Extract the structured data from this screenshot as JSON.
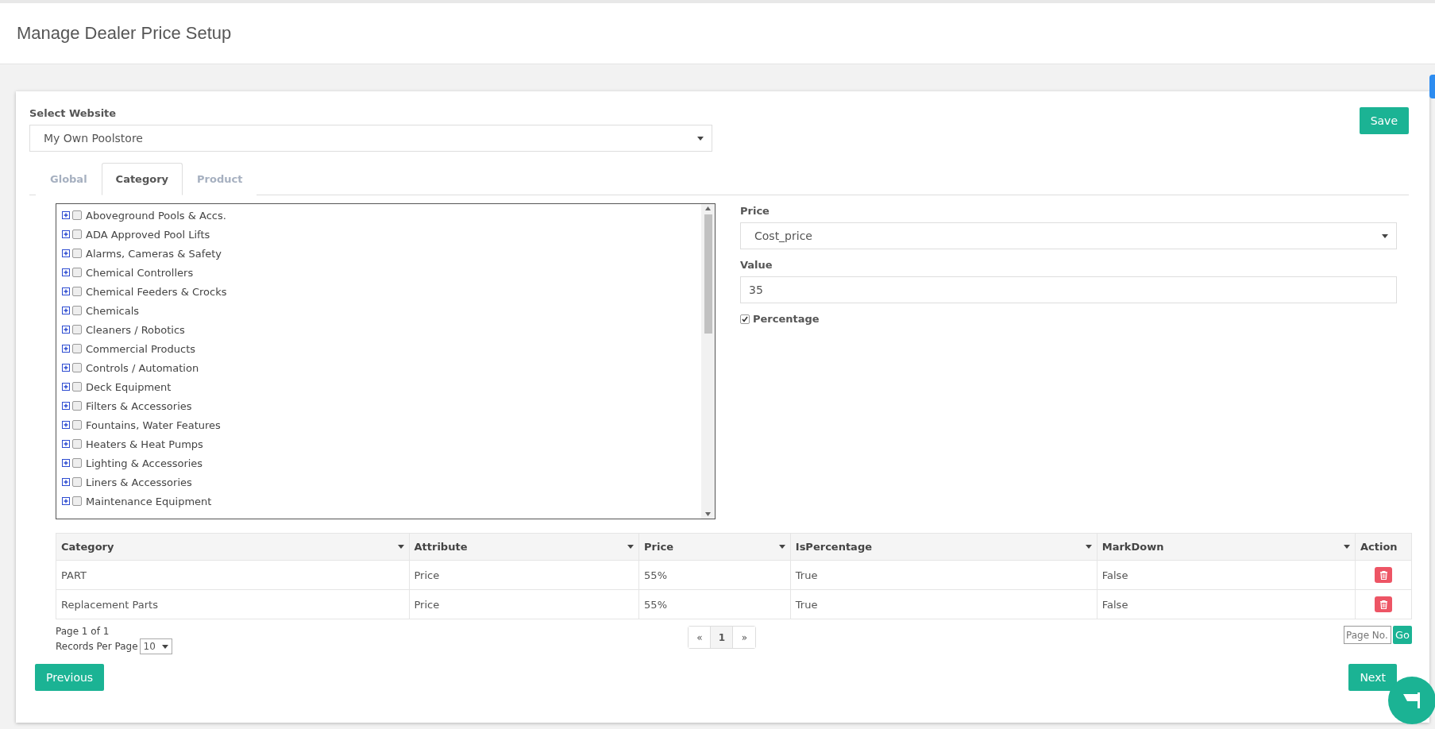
{
  "page_title": "Manage Dealer Price Setup",
  "website": {
    "label": "Select Website",
    "value": "My Own Poolstore"
  },
  "save_button": "Save",
  "tabs": [
    {
      "label": "Global",
      "selected": false
    },
    {
      "label": "Category",
      "selected": true
    },
    {
      "label": "Product",
      "selected": false
    }
  ],
  "category_tree": [
    {
      "label": "Aboveground Pools & Accs.",
      "checked": false,
      "expanded": false
    },
    {
      "label": "ADA Approved Pool Lifts",
      "checked": false,
      "expanded": false
    },
    {
      "label": "Alarms, Cameras & Safety",
      "checked": false,
      "expanded": false
    },
    {
      "label": "Chemical Controllers",
      "checked": false,
      "expanded": false
    },
    {
      "label": "Chemical Feeders & Crocks",
      "checked": false,
      "expanded": false
    },
    {
      "label": "Chemicals",
      "checked": false,
      "expanded": false
    },
    {
      "label": "Cleaners / Robotics",
      "checked": false,
      "expanded": false
    },
    {
      "label": "Commercial Products",
      "checked": false,
      "expanded": false
    },
    {
      "label": "Controls / Automation",
      "checked": false,
      "expanded": false
    },
    {
      "label": "Deck Equipment",
      "checked": false,
      "expanded": false
    },
    {
      "label": "Filters & Accessories",
      "checked": false,
      "expanded": false
    },
    {
      "label": "Fountains, Water Features",
      "checked": false,
      "expanded": false
    },
    {
      "label": "Heaters & Heat Pumps",
      "checked": false,
      "expanded": false
    },
    {
      "label": "Lighting & Accessories",
      "checked": false,
      "expanded": false
    },
    {
      "label": "Liners & Accessories",
      "checked": false,
      "expanded": false
    },
    {
      "label": "Maintenance Equipment",
      "checked": false,
      "expanded": false
    }
  ],
  "price": {
    "label": "Price",
    "value": "Cost_price"
  },
  "value": {
    "label": "Value",
    "value": "35"
  },
  "percentage": {
    "label": "Percentage",
    "checked": true
  },
  "table": {
    "columns": [
      "Category",
      "Attribute",
      "Price",
      "IsPercentage",
      "MarkDown",
      "Action"
    ],
    "rows": [
      [
        "PART",
        "Price",
        "55%",
        "True",
        "False"
      ],
      [
        "Replacement Parts",
        "Price",
        "55%",
        "True",
        "False"
      ]
    ]
  },
  "pagination": {
    "page_info": "Page 1 of 1",
    "records_label": "Records Per Page",
    "records_value": "10",
    "prev": "«",
    "pages": [
      {
        "label": "1",
        "selected": true
      }
    ],
    "next": "»",
    "page_no_placeholder": "Page No.",
    "go": "Go"
  },
  "previous_button": "Previous",
  "next_button": "Next"
}
